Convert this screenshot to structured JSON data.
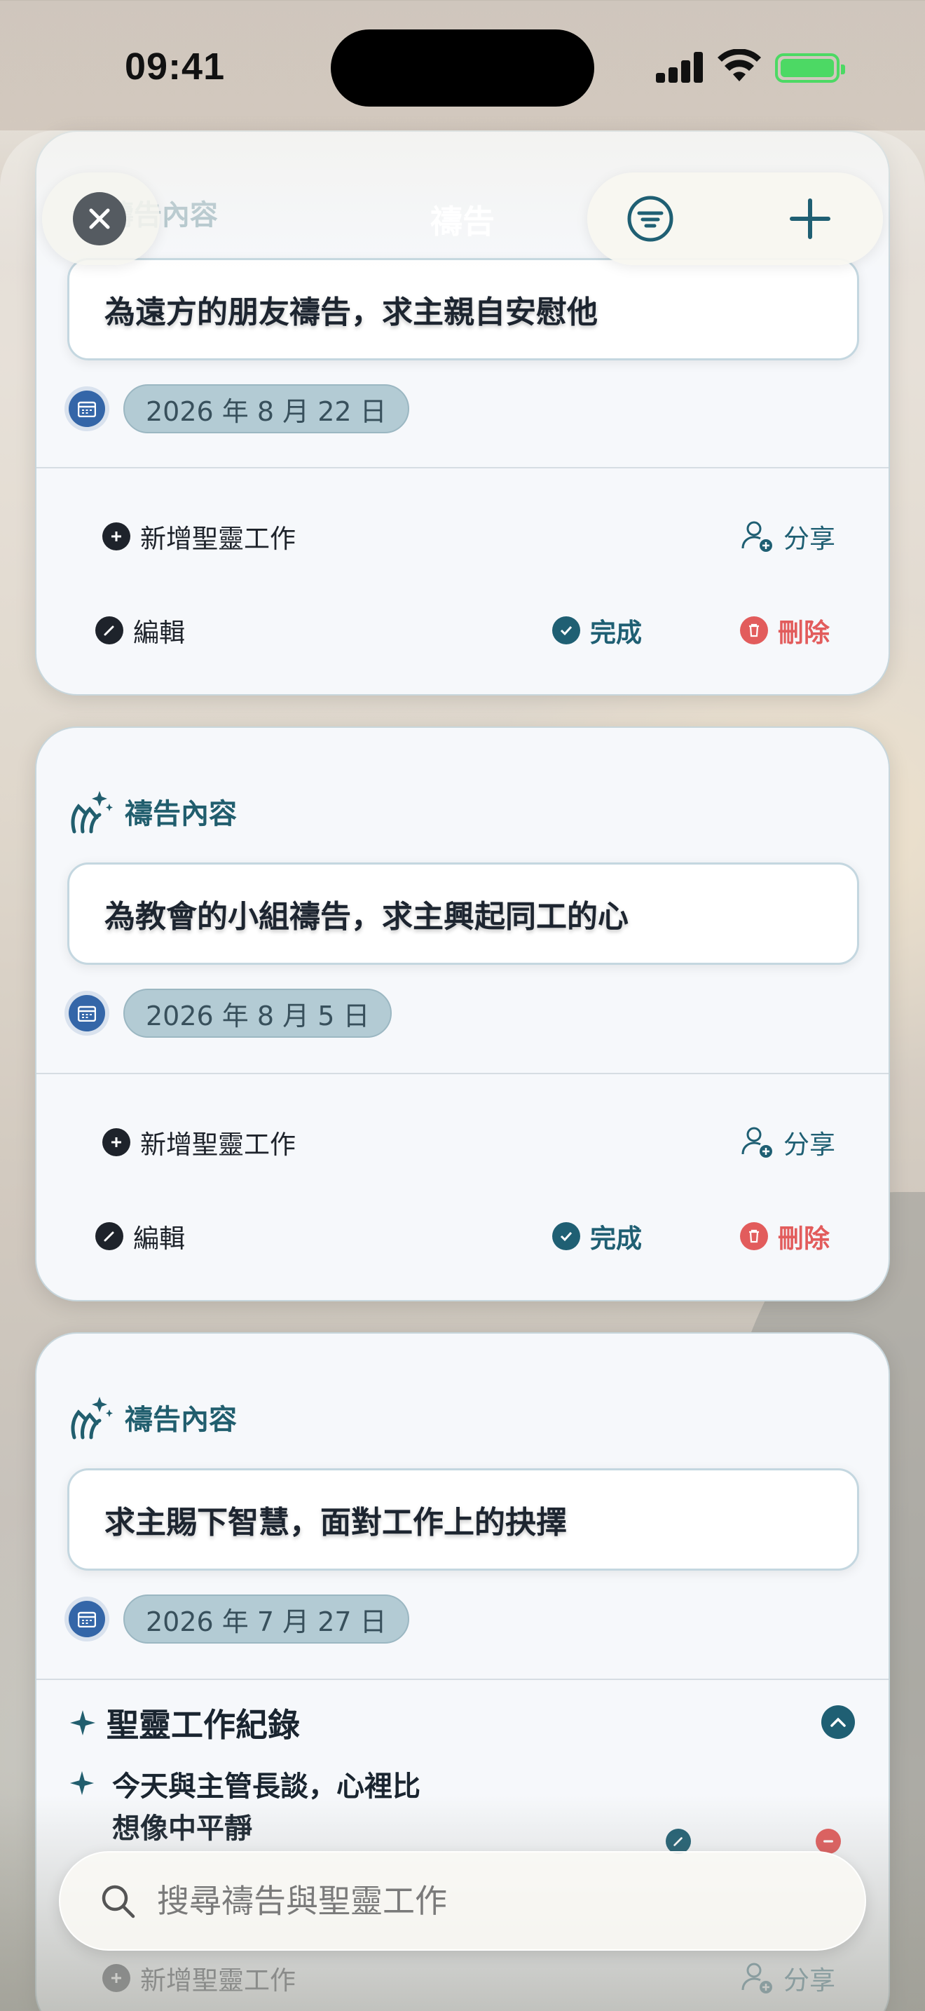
{
  "status_bar": {
    "time": "09:41"
  },
  "nav": {
    "title": "禱告"
  },
  "search": {
    "placeholder": "搜尋禱告與聖靈工作"
  },
  "cards": [
    {
      "section_label": "禱告內容",
      "content": "為遠方的朋友禱告，求主親自安慰他",
      "date": "2026 年 8 月 22 日",
      "add_label": "新增聖靈工作",
      "share_label": "分享",
      "edit_label": "編輯",
      "complete_label": "完成",
      "delete_label": "刪除"
    },
    {
      "section_label": "禱告內容",
      "content": "為教會的小組禱告，求主興起同工的心",
      "date": "2026 年 8 月 5 日",
      "add_label": "新增聖靈工作",
      "share_label": "分享",
      "edit_label": "編輯",
      "complete_label": "完成",
      "delete_label": "刪除"
    },
    {
      "section_label": "禱告內容",
      "content": "求主賜下智慧，面對工作上的抉擇",
      "date": "2026 年 7 月 27 日",
      "spirit_section": {
        "title": "聖靈工作紀錄",
        "entries": [
          {
            "text_line1": "今天與主管長談，心裡比",
            "text_line2": "想像中平靜"
          }
        ]
      },
      "add_label": "新增聖靈工作",
      "share_label": "分享"
    }
  ],
  "colors": {
    "accent": "#1f5f73",
    "danger": "#e25c5c",
    "calendar": "#3466a8"
  }
}
